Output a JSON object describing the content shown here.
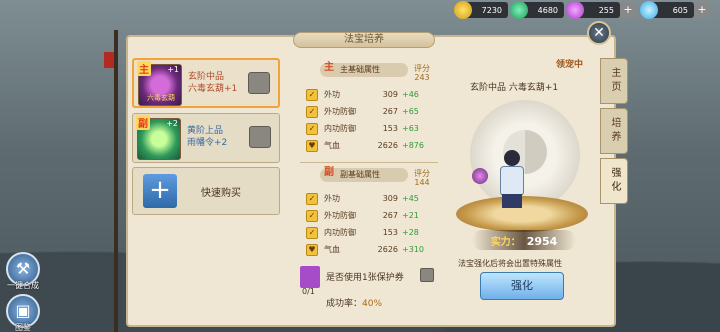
{
  "resources": [
    {
      "name": "gold",
      "icon": "gold-coin-icon",
      "value": "7230"
    },
    {
      "name": "jade",
      "icon": "jade-icon",
      "value": "4680"
    },
    {
      "name": "pink",
      "icon": "pink-gem-icon",
      "value": "255"
    },
    {
      "name": "diamond",
      "icon": "diamond-icon",
      "value": "605"
    }
  ],
  "panel": {
    "title": "法宝培养"
  },
  "items": [
    {
      "tag": "主",
      "plus": "+1",
      "quality": "玄阶中品",
      "name": "六毒玄葫+1",
      "overlay": "六毒玄葫"
    },
    {
      "tag": "副",
      "plus": "+2",
      "quality": "黄阶上品",
      "name": "雨幡令+2",
      "overlay": ""
    }
  ],
  "quick_buy": {
    "label": "快速购买"
  },
  "main_attr": {
    "title": "主基础属性",
    "tag": "主",
    "score_label": "评分",
    "score": "243",
    "rows": [
      {
        "label": "外功",
        "value": "309",
        "inc": "+46"
      },
      {
        "label": "外功防御",
        "value": "267",
        "inc": "+65"
      },
      {
        "label": "内功防御",
        "value": "153",
        "inc": "+63"
      },
      {
        "label": "气血",
        "value": "2626",
        "inc": "+876"
      }
    ]
  },
  "sub_attr": {
    "title": "副基础属性",
    "tag": "副",
    "score_label": "评分",
    "score": "144",
    "rows": [
      {
        "label": "外功",
        "value": "309",
        "inc": "+45"
      },
      {
        "label": "外功防御",
        "value": "267",
        "inc": "+21"
      },
      {
        "label": "内功防御",
        "value": "153",
        "inc": "+28"
      },
      {
        "label": "气血",
        "value": "2626",
        "inc": "+310"
      }
    ]
  },
  "protect": {
    "count": "0/1",
    "label": "是否使用1张保护券"
  },
  "success": {
    "label": "成功率：",
    "value": "40%"
  },
  "preview": {
    "title": "玄阶中品 六毒玄葫+1",
    "status": "领宠中",
    "power_label": "实力：",
    "power_value": "2954",
    "hint": "法宝强化后将会出置特殊属性",
    "button": "强化"
  },
  "tabs": [
    {
      "label": "主页"
    },
    {
      "label": "培养"
    },
    {
      "label": "强化"
    }
  ],
  "side": {
    "merge": "一键合成",
    "album": "图鉴"
  }
}
